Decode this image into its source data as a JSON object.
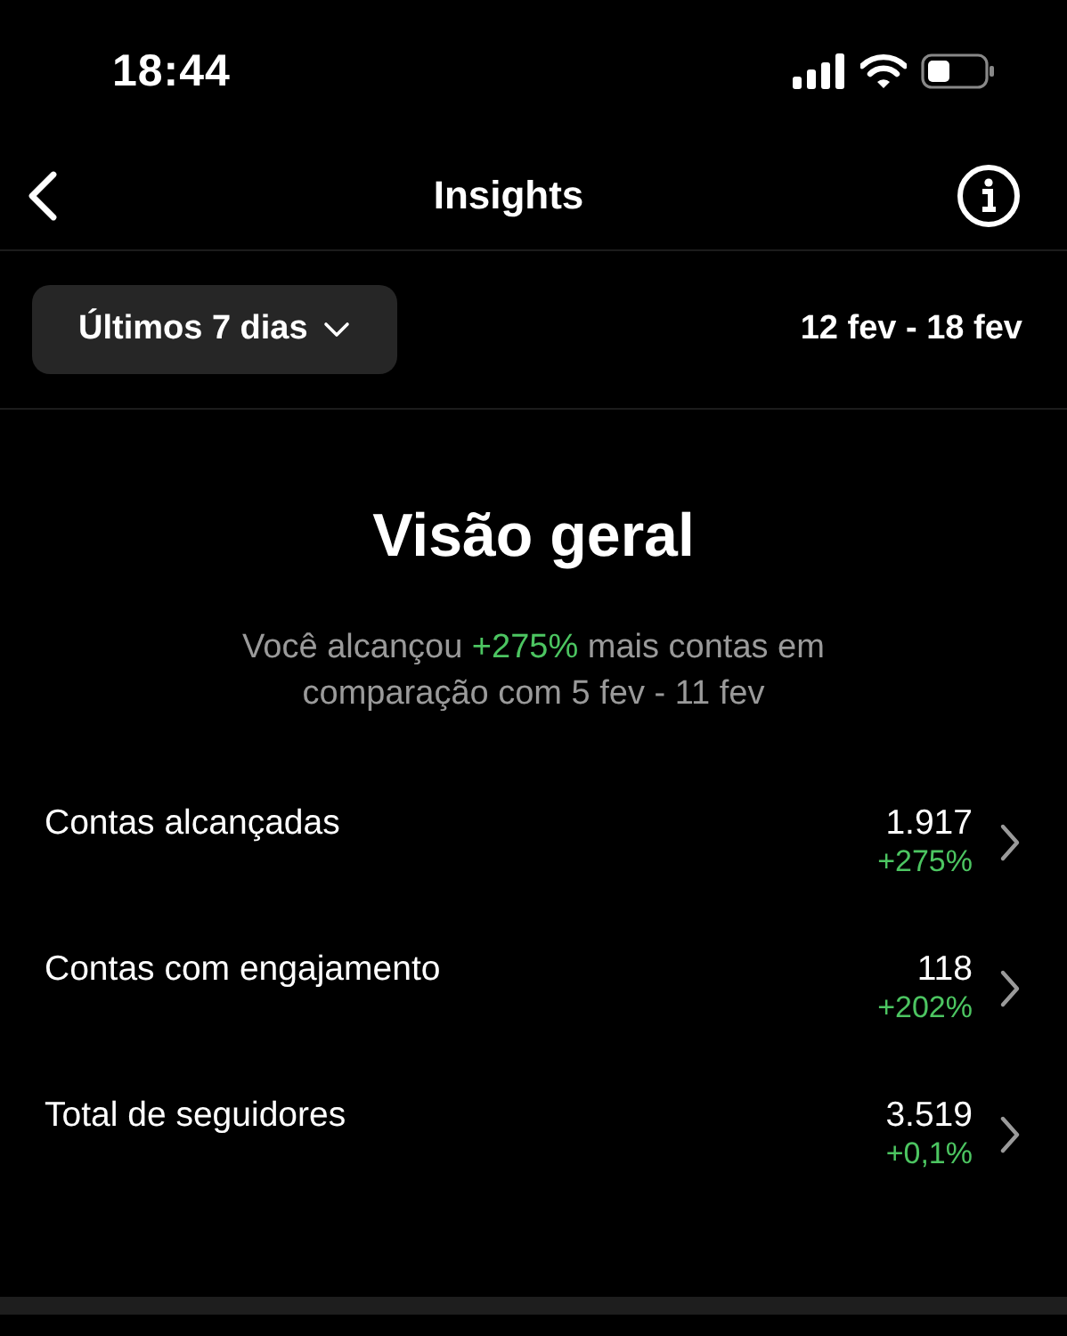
{
  "status_bar": {
    "time": "18:44"
  },
  "nav": {
    "title": "Insights"
  },
  "filter": {
    "range_button": "Últimos 7 dias",
    "dates": "12 fev - 18 fev"
  },
  "overview": {
    "title": "Visão geral",
    "summary": {
      "before": "Você alcançou ",
      "highlight": "+275%",
      "after": " mais contas em comparação com 5 fev - 11 fev"
    }
  },
  "metrics": [
    {
      "label": "Contas alcançadas",
      "value": "1.917",
      "change": "+275%"
    },
    {
      "label": "Contas com engajamento",
      "value": "118",
      "change": "+202%"
    },
    {
      "label": "Total de seguidores",
      "value": "3.519",
      "change": "+0,1%"
    }
  ]
}
